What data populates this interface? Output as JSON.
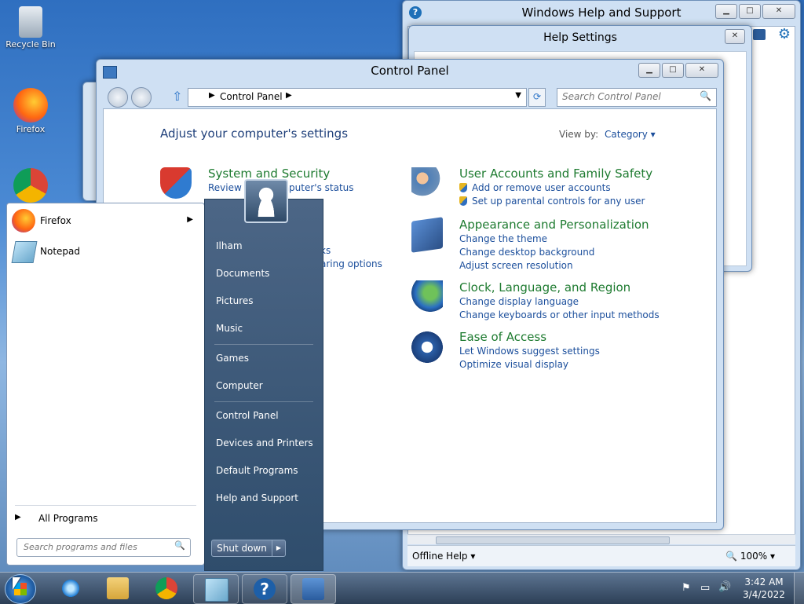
{
  "desktop": {
    "icons": [
      {
        "label": "Recycle Bin"
      },
      {
        "label": "Firefox"
      },
      {
        "label": ""
      }
    ]
  },
  "help_window": {
    "title": "Windows Help and Support",
    "dialog_title": "Help Settings",
    "offline_help": "Offline Help",
    "zoom": "100%"
  },
  "control_panel": {
    "title": "Control Panel",
    "breadcrumb": "Control Panel",
    "search_placeholder": "Search Control Panel",
    "heading": "Adjust your computer's settings",
    "view_by_label": "View by:",
    "view_by_value": "Category",
    "categories": [
      {
        "title": "System and Security",
        "links": [
          "Review your computer's status"
        ]
      },
      {
        "title": "User Accounts and Family Safety",
        "links": [
          "Add or remove user accounts",
          "Set up parental controls for any user"
        ]
      },
      {
        "title": "Appearance and Personalization",
        "links": [
          "Change the theme",
          "Change desktop background",
          "Adjust screen resolution"
        ]
      },
      {
        "title": "Clock, Language, and Region",
        "links": [
          "Change display language",
          "Change keyboards or other input methods"
        ]
      },
      {
        "title": "Ease of Access",
        "links": [
          "Let Windows suggest settings",
          "Optimize visual display"
        ]
      }
    ],
    "partial_links": [
      "ks",
      "aring options"
    ]
  },
  "start_menu": {
    "programs": [
      {
        "label": "Firefox"
      },
      {
        "label": "Notepad"
      }
    ],
    "all_programs": "All Programs",
    "search_placeholder": "Search programs and files",
    "right_items": [
      "Ilham",
      "Documents",
      "Pictures",
      "Music",
      "Games",
      "Computer",
      "Control Panel",
      "Devices and Printers",
      "Default Programs",
      "Help and Support"
    ],
    "shutdown": "Shut down"
  },
  "taskbar": {
    "time": "3:42 AM",
    "date": "3/4/2022"
  }
}
